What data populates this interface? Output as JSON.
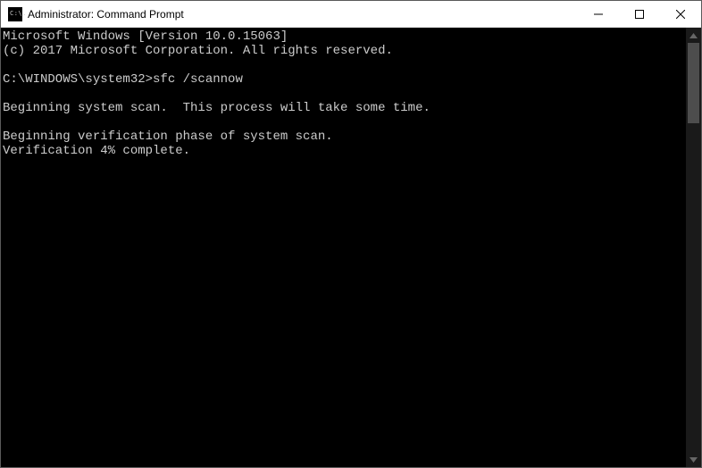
{
  "window": {
    "title": "Administrator: Command Prompt",
    "icon_text": "C:\\."
  },
  "terminal": {
    "line1": "Microsoft Windows [Version 10.0.15063]",
    "line2": "(c) 2017 Microsoft Corporation. All rights reserved.",
    "blank1": "",
    "prompt_line": "C:\\WINDOWS\\system32>sfc /scannow",
    "blank2": "",
    "scan_line": "Beginning system scan.  This process will take some time.",
    "blank3": "",
    "verify_phase": "Beginning verification phase of system scan.",
    "verify_progress": "Verification 4% complete."
  }
}
